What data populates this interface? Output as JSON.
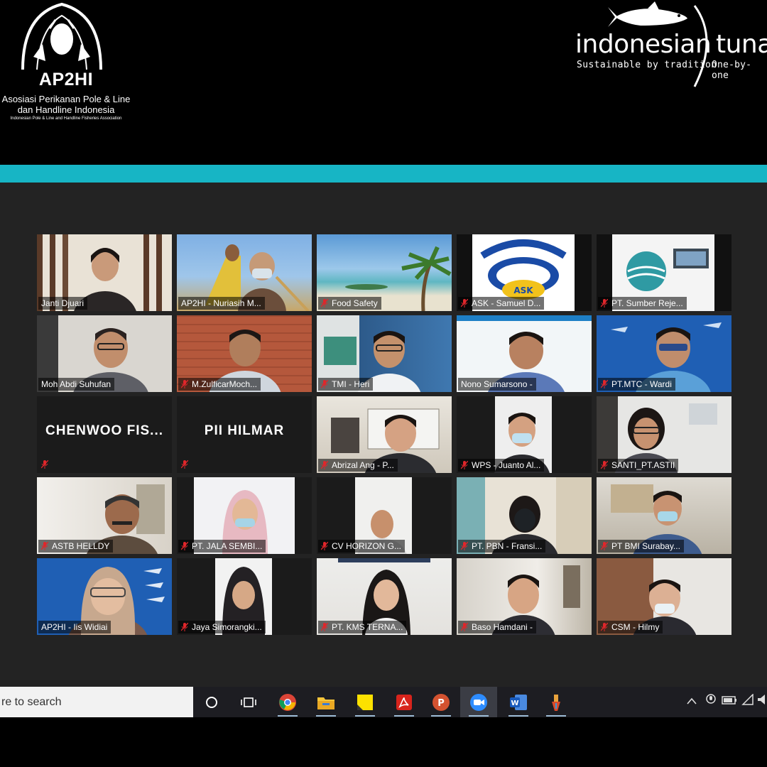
{
  "header": {
    "ap2hi": {
      "name": "AP2HI",
      "subtitle_line1": "Asosiasi Perikanan Pole & Line",
      "subtitle_line2": "dan Handline Indonesia",
      "subtitle_line3": "Indonesian Pole & Line and Handline Fisheries Association"
    },
    "tuna": {
      "word1": "indonesian",
      "word2": "tuna",
      "tagline1": "Sustainable by tradition",
      "tagline2": "One-by-one"
    }
  },
  "colors": {
    "accent_bar": "#17b5c5",
    "active_speaker_border": "#c6d93a",
    "muted_mic": "#e0262b"
  },
  "participants": [
    {
      "name": "Janti Djuari",
      "muted": false,
      "active": true
    },
    {
      "name": "AP2HI - Nuriasih M...",
      "muted": false
    },
    {
      "name": "Food Safety",
      "muted": true
    },
    {
      "name": "ASK - Samuel D...",
      "muted": true
    },
    {
      "name": "PT. Sumber Reje...",
      "muted": true
    },
    {
      "name": "Moh Abdi Suhufan",
      "muted": false
    },
    {
      "name": "M.ZulficarMoch...",
      "muted": true
    },
    {
      "name": "TMI - Heri",
      "muted": true
    },
    {
      "name": "Nono Sumarsono -",
      "muted": false
    },
    {
      "name": "PT.MTC - Wardi",
      "muted": true
    },
    {
      "title": "CHENWOO  FIS...",
      "muted": true
    },
    {
      "title": "PII HILMAR",
      "muted": true
    },
    {
      "name": "Abrizal Ang - P...",
      "muted": true
    },
    {
      "name": "WPS - Juanto Al...",
      "muted": true
    },
    {
      "name": "SANTI_PT.ASTII",
      "muted": true
    },
    {
      "name": "ASTB HELLDY",
      "muted": true
    },
    {
      "name": "PT. JALA SEMBI...",
      "muted": true
    },
    {
      "name": "CV HORIZON G...",
      "muted": true
    },
    {
      "name": "PT. PBN - Fransi...",
      "muted": true
    },
    {
      "name": "PT BMI Surabay...",
      "muted": true
    },
    {
      "name": "AP2HI - Iis Widiai",
      "muted": false
    },
    {
      "name": "Jaya Simorangki...",
      "muted": true
    },
    {
      "name": "PT. KMS TERNA...",
      "muted": true
    },
    {
      "name": "Baso Hamdani -",
      "muted": true
    },
    {
      "name": "CSM - Hilmy",
      "muted": true
    }
  ],
  "taskbar": {
    "search_placeholder": "re to search",
    "apps": [
      "search-circle",
      "task-view",
      "chrome",
      "file-explorer",
      "sticky-notes",
      "acrobat",
      "powerpoint",
      "zoom",
      "word",
      "paint"
    ]
  }
}
